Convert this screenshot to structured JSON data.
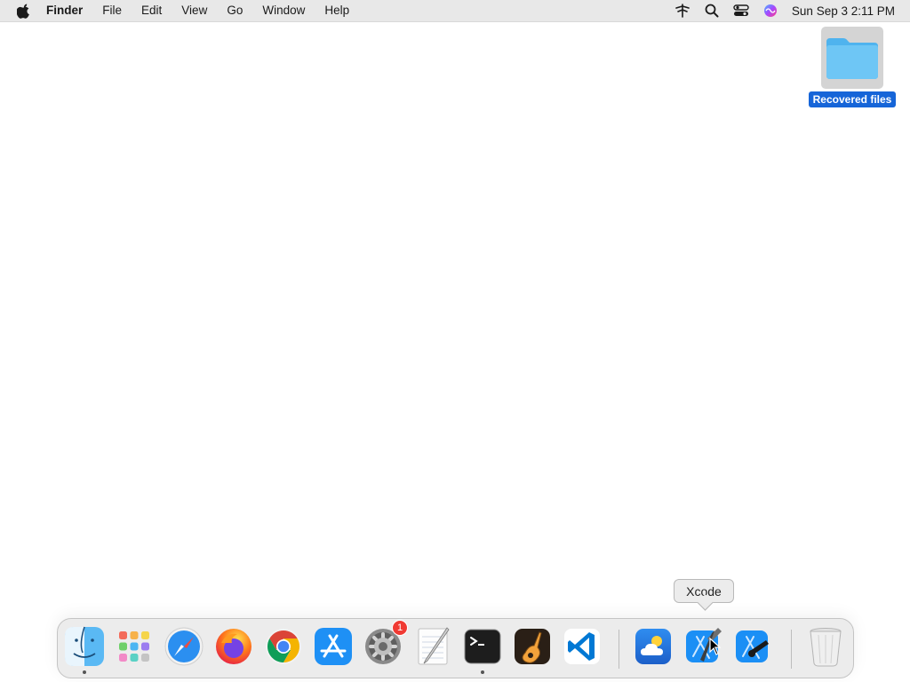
{
  "menubar": {
    "apple_icon": "apple-icon",
    "app_name": "Finder",
    "items": [
      "File",
      "Edit",
      "View",
      "Go",
      "Window",
      "Help"
    ],
    "status_icons": [
      "vpn-icon",
      "search-icon",
      "control-center-icon",
      "siri-icon"
    ],
    "clock": "Sun Sep 3  2:11 PM"
  },
  "desktop": {
    "icons": [
      {
        "label": "Recovered files",
        "icon": "folder-icon",
        "selected": true
      }
    ]
  },
  "tooltip": {
    "text": "Xcode"
  },
  "dock": {
    "items": [
      {
        "name": "Finder",
        "icon": "finder-icon",
        "running": true
      },
      {
        "name": "Launchpad",
        "icon": "launchpad-icon"
      },
      {
        "name": "Safari",
        "icon": "safari-icon"
      },
      {
        "name": "Firefox",
        "icon": "firefox-icon"
      },
      {
        "name": "Google Chrome",
        "icon": "chrome-icon"
      },
      {
        "name": "App Store",
        "icon": "app-store-icon"
      },
      {
        "name": "System Preferences",
        "icon": "system-preferences-icon",
        "badge": "1"
      },
      {
        "name": "TextEdit",
        "icon": "textedit-icon"
      },
      {
        "name": "Terminal",
        "icon": "terminal-icon",
        "running": true
      },
      {
        "name": "GarageBand",
        "icon": "garageband-icon"
      },
      {
        "name": "Visual Studio Code",
        "icon": "vscode-icon"
      },
      {
        "name": "Weather",
        "icon": "weather-icon"
      },
      {
        "name": "Xcode",
        "icon": "xcode-icon"
      },
      {
        "name": "Instruments",
        "icon": "instruments-icon"
      },
      {
        "name": "Trash",
        "icon": "trash-icon"
      }
    ]
  }
}
